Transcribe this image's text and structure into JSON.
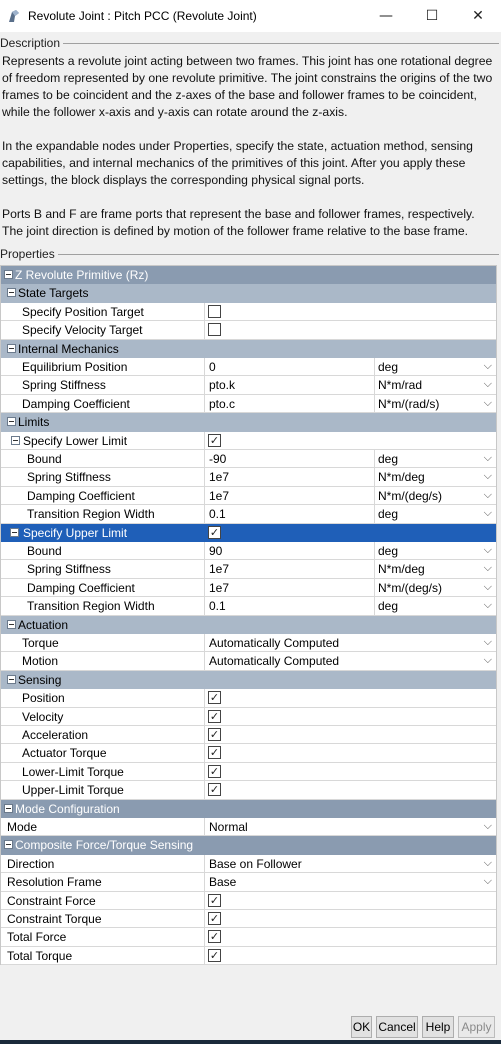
{
  "window": {
    "title": "Revolute Joint : Pitch PCC  (Revolute Joint)",
    "minimize_glyph": "—",
    "maximize_glyph": "☐",
    "close_glyph": "✕"
  },
  "description": {
    "group_label": "Description",
    "paragraphs": [
      "Represents a revolute joint acting between two frames. This joint has one rotational degree of freedom represented by one revolute primitive. The joint constrains the origins of the two frames to be coincident and the z-axes of the base and follower frames to be coincident, while the follower x-axis and y-axis can rotate around the z-axis.",
      "In the expandable nodes under Properties, specify the state, actuation method, sensing capabilities, and internal mechanics of the primitives of this joint. After you apply these settings, the block displays the corresponding physical signal ports.",
      "Ports B and F are frame ports that represent the base and follower frames, respectively. The joint direction is defined by motion of the follower frame relative to the base frame."
    ]
  },
  "properties": {
    "group_label": "Properties",
    "rows": [
      {
        "kind": "section",
        "label": "Z Revolute Primitive (Rz)",
        "indent": 0
      },
      {
        "kind": "sub",
        "label": "State Targets",
        "indent": 1
      },
      {
        "kind": "check",
        "label": "Specify Position Target",
        "checked": false,
        "indent": 2
      },
      {
        "kind": "check",
        "label": "Specify Velocity Target",
        "checked": false,
        "indent": 2
      },
      {
        "kind": "sub",
        "label": "Internal Mechanics",
        "indent": 1
      },
      {
        "kind": "unit",
        "label": "Equilibrium Position",
        "value": "0",
        "unit": "deg",
        "indent": 2
      },
      {
        "kind": "unit",
        "label": "Spring Stiffness",
        "value": "pto.k",
        "unit": "N*m/rad",
        "indent": 2
      },
      {
        "kind": "unit",
        "label": "Damping Coefficient",
        "value": "pto.c",
        "unit": "N*m/(rad/s)",
        "indent": 2
      },
      {
        "kind": "sub",
        "label": "Limits",
        "indent": 1
      },
      {
        "kind": "checkgroup",
        "label": "Specify Lower Limit",
        "checked": true,
        "indent": 2
      },
      {
        "kind": "unit",
        "label": "Bound",
        "value": "-90",
        "unit": "deg",
        "indent": 3
      },
      {
        "kind": "unit",
        "label": "Spring Stiffness",
        "value": "1e7",
        "unit": "N*m/deg",
        "indent": 3
      },
      {
        "kind": "unit",
        "label": "Damping Coefficient",
        "value": "1e7",
        "unit": "N*m/(deg/s)",
        "indent": 3
      },
      {
        "kind": "unit",
        "label": "Transition Region Width",
        "value": "0.1",
        "unit": "deg",
        "indent": 3
      },
      {
        "kind": "checkgroup",
        "label": "Specify Upper Limit",
        "checked": true,
        "indent": 2,
        "selected": true
      },
      {
        "kind": "unit",
        "label": "Bound",
        "value": "90",
        "unit": "deg",
        "indent": 3
      },
      {
        "kind": "unit",
        "label": "Spring Stiffness",
        "value": "1e7",
        "unit": "N*m/deg",
        "indent": 3
      },
      {
        "kind": "unit",
        "label": "Damping Coefficient",
        "value": "1e7",
        "unit": "N*m/(deg/s)",
        "indent": 3
      },
      {
        "kind": "unit",
        "label": "Transition Region Width",
        "value": "0.1",
        "unit": "deg",
        "indent": 3
      },
      {
        "kind": "sub",
        "label": "Actuation",
        "indent": 1
      },
      {
        "kind": "select",
        "label": "Torque",
        "value": "Automatically Computed",
        "indent": 2
      },
      {
        "kind": "select",
        "label": "Motion",
        "value": "Automatically Computed",
        "indent": 2
      },
      {
        "kind": "sub",
        "label": "Sensing",
        "indent": 1
      },
      {
        "kind": "check",
        "label": "Position",
        "checked": true,
        "indent": 2
      },
      {
        "kind": "check",
        "label": "Velocity",
        "checked": true,
        "indent": 2
      },
      {
        "kind": "check",
        "label": "Acceleration",
        "checked": true,
        "indent": 2
      },
      {
        "kind": "check",
        "label": "Actuator Torque",
        "checked": true,
        "indent": 2
      },
      {
        "kind": "check",
        "label": "Lower-Limit Torque",
        "checked": true,
        "indent": 2
      },
      {
        "kind": "check",
        "label": "Upper-Limit Torque",
        "checked": true,
        "indent": 2
      },
      {
        "kind": "section",
        "label": "Mode Configuration",
        "indent": 0
      },
      {
        "kind": "select",
        "label": "Mode",
        "value": "Normal",
        "indent": 1
      },
      {
        "kind": "section",
        "label": "Composite Force/Torque Sensing",
        "indent": 0
      },
      {
        "kind": "select",
        "label": "Direction",
        "value": "Base on Follower",
        "indent": 1
      },
      {
        "kind": "select",
        "label": "Resolution Frame",
        "value": "Base",
        "indent": 1
      },
      {
        "kind": "check",
        "label": "Constraint Force",
        "checked": true,
        "indent": 1
      },
      {
        "kind": "check",
        "label": "Constraint Torque",
        "checked": true,
        "indent": 1
      },
      {
        "kind": "check",
        "label": "Total Force",
        "checked": true,
        "indent": 1
      },
      {
        "kind": "check",
        "label": "Total Torque",
        "checked": true,
        "indent": 1
      }
    ]
  },
  "footer": {
    "ok": "OK",
    "cancel": "Cancel",
    "help": "Help",
    "apply": "Apply"
  },
  "icons": {
    "dropdown": "chevron-down-icon",
    "check_glyph": "✓",
    "colors": {
      "section_bg": "#8a9bb0",
      "sub_bg": "#aab8c8",
      "selected_bg": "#1f5fb8"
    }
  }
}
